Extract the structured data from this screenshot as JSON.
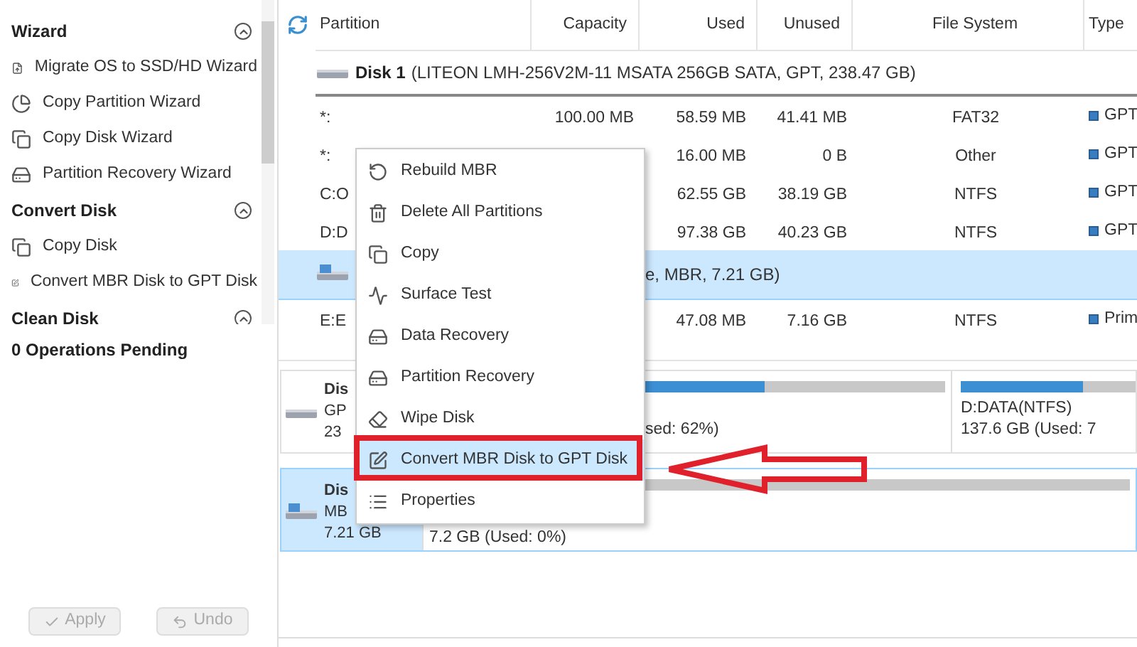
{
  "sidebar": {
    "sections": [
      {
        "title": "Wizard",
        "expanded": true,
        "items": [
          "Migrate OS to SSD/HD Wizard",
          "Copy Partition Wizard",
          "Copy Disk Wizard",
          "Partition Recovery Wizard"
        ]
      },
      {
        "title": "Convert Disk",
        "expanded": true,
        "items": [
          "Copy Disk",
          "Convert MBR Disk to GPT Disk"
        ]
      },
      {
        "title": "Clean Disk",
        "expanded": true
      }
    ],
    "pending": "0 Operations Pending",
    "buttons": [
      {
        "label": "Apply",
        "disabled": true
      },
      {
        "label": "Undo",
        "disabled": true
      }
    ]
  },
  "table": {
    "columns": [
      "Partition",
      "Capacity",
      "Used",
      "Unused",
      "File System",
      "Type"
    ],
    "rows": [
      {
        "kind": "disk",
        "name": "Disk 1",
        "details": "(LITEON LMH-256V2M-11 MSATA 256GB SATA, GPT, 238.47 GB)",
        "selected": false
      },
      {
        "kind": "partition",
        "partition": "*:",
        "capacity": "100.00 MB",
        "used": "58.59 MB",
        "unused": "41.41 MB",
        "file_system": "FAT32",
        "type": "GPT"
      },
      {
        "kind": "partition",
        "partition": "*:",
        "used": "16.00 MB",
        "unused": "0 B",
        "file_system": "Other",
        "type": "GPT"
      },
      {
        "kind": "partition",
        "partition": "C:O",
        "used": "62.55 GB",
        "unused": "38.19 GB",
        "file_system": "NTFS",
        "type": "GPT"
      },
      {
        "kind": "partition",
        "partition": "D:D",
        "used": "97.38 GB",
        "unused": "40.23 GB",
        "file_system": "NTFS",
        "type": "GPT"
      },
      {
        "kind": "usb",
        "details": "e, MBR, 7.21 GB)",
        "selected": true
      },
      {
        "kind": "partition",
        "partition": "E:E",
        "used": "47.08 MB",
        "unused": "7.16 GB",
        "file_system": "NTFS",
        "type": "Prim"
      }
    ]
  },
  "disk_map": [
    {
      "kind": "disk",
      "selected": false,
      "lines": [
        "Dis",
        "GP",
        "23"
      ],
      "partitions": [
        {
          "text": "sed: 62%)",
          "level": 0.62
        },
        {
          "label": "D:DATA(NTFS)",
          "text": "137.6 GB (Used: 7",
          "level": 0.7
        }
      ]
    },
    {
      "kind": "usb",
      "selected": true,
      "lines": [
        "Dis",
        "MB",
        "7.21 GB"
      ],
      "partitions": [
        {
          "text": "7.2 GB (Used: 0%)"
        }
      ]
    }
  ],
  "context_menu": {
    "items": [
      {
        "label": "Rebuild MBR",
        "selected": false
      },
      {
        "label": "Delete All Partitions",
        "selected": false
      },
      {
        "label": "Copy",
        "selected": false
      },
      {
        "label": "Surface Test",
        "selected": false
      },
      {
        "label": "Data Recovery",
        "selected": false
      },
      {
        "label": "Partition Recovery",
        "selected": false
      },
      {
        "label": "Wipe Disk",
        "selected": false
      },
      {
        "label": "Convert MBR Disk to GPT Disk",
        "selected": true
      },
      {
        "label": "Properties",
        "selected": false
      }
    ]
  }
}
